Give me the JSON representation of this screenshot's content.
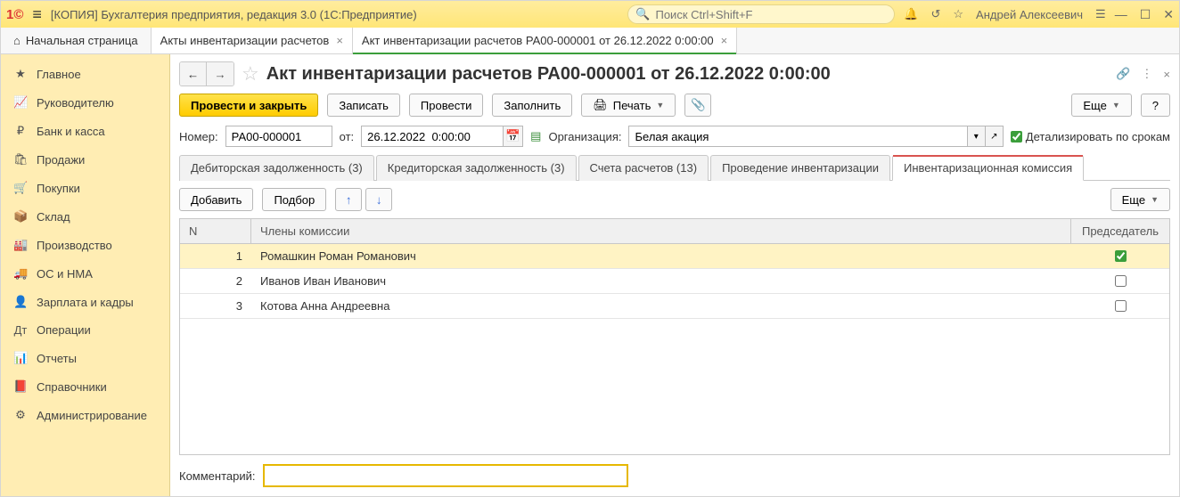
{
  "titlebar": {
    "app_title": "[КОПИЯ] Бухгалтерия предприятия, редакция 3.0  (1С:Предприятие)",
    "search_placeholder": "Поиск Ctrl+Shift+F",
    "user_name": "Андрей Алексеевич"
  },
  "navtabs": {
    "home": "Начальная страница",
    "tab1": "Акты инвентаризации расчетов",
    "tab2": "Акт инвентаризации расчетов РА00-000001 от 26.12.2022 0:00:00"
  },
  "sidebar": {
    "items": [
      {
        "label": "Главное"
      },
      {
        "label": "Руководителю"
      },
      {
        "label": "Банк и касса"
      },
      {
        "label": "Продажи"
      },
      {
        "label": "Покупки"
      },
      {
        "label": "Склад"
      },
      {
        "label": "Производство"
      },
      {
        "label": "ОС и НМА"
      },
      {
        "label": "Зарплата и кадры"
      },
      {
        "label": "Операции"
      },
      {
        "label": "Отчеты"
      },
      {
        "label": "Справочники"
      },
      {
        "label": "Администрирование"
      }
    ]
  },
  "document": {
    "title": "Акт инвентаризации расчетов РА00-000001 от 26.12.2022 0:00:00",
    "post_and_close": "Провести и закрыть",
    "record": "Записать",
    "post": "Провести",
    "fill": "Заполнить",
    "print": "Печать",
    "more": "Еще",
    "help": "?",
    "number_label": "Номер:",
    "number_value": "РА00-000001",
    "from_label": "от:",
    "date_value": "26.12.2022  0:00:00",
    "org_label": "Организация:",
    "org_value": "Белая акация",
    "detail_check": "Детализировать по срокам"
  },
  "doctabs": {
    "t0": "Дебиторская задолженность (3)",
    "t1": "Кредиторская задолженность (3)",
    "t2": "Счета расчетов (13)",
    "t3": "Проведение инвентаризации",
    "t4": "Инвентаризационная комиссия"
  },
  "table": {
    "add": "Добавить",
    "pick": "Подбор",
    "more": "Еще",
    "col_n": "N",
    "col_members": "Члены комиссии",
    "col_chair": "Председатель",
    "rows": [
      {
        "n": "1",
        "name": "Ромашкин Роман Романович",
        "chair": true
      },
      {
        "n": "2",
        "name": "Иванов Иван Иванович",
        "chair": false
      },
      {
        "n": "3",
        "name": "Котова  Анна Андреевна",
        "chair": false
      }
    ]
  },
  "comment": {
    "label": "Комментарий:",
    "value": ""
  }
}
